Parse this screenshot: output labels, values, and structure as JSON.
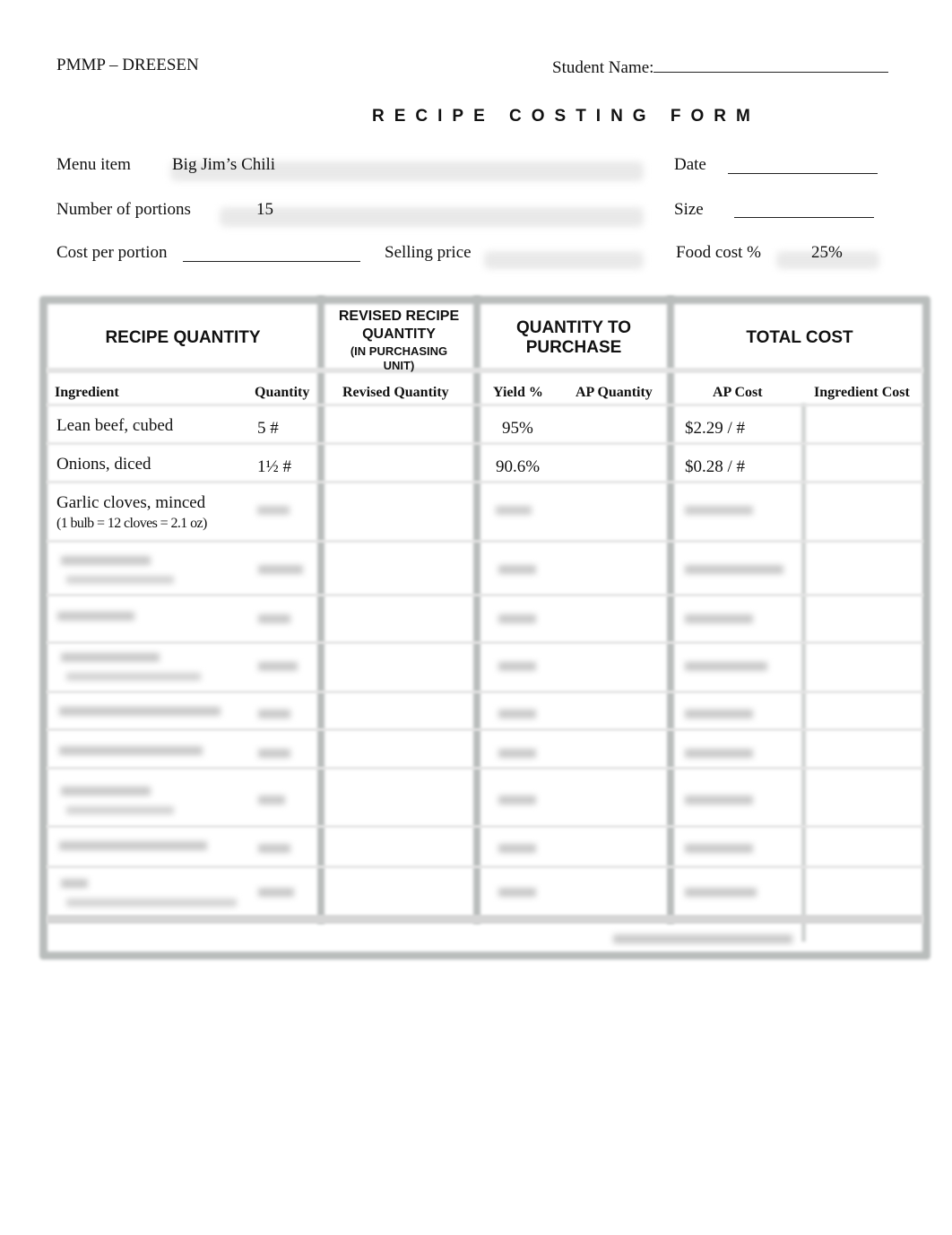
{
  "header": {
    "left": "PMMP – DREESEN",
    "student_name_label": "Student Name:"
  },
  "form_title": "RECIPE COSTING FORM",
  "fields": {
    "menu_item_label": "Menu item",
    "menu_item_value": "Big Jim’s Chili",
    "date_label": "Date",
    "portions_label": "Number of portions",
    "portions_value": "15",
    "size_label": "Size",
    "cost_per_portion_label": "Cost per portion",
    "selling_price_label": "Selling price",
    "food_cost_label": "Food cost %",
    "food_cost_value": "25%"
  },
  "table": {
    "group_headers": {
      "recipe_quantity": "RECIPE QUANTITY",
      "revised_line1": "REVISED RECIPE",
      "revised_line2": "QUANTITY",
      "revised_line3": "(IN PURCHASING",
      "revised_line4": "UNIT)",
      "purchase_line1": "QUANTITY TO",
      "purchase_line2": "PURCHASE",
      "total_cost": "TOTAL COST"
    },
    "columns": {
      "ingredient": "Ingredient",
      "quantity": "Quantity",
      "revised_quantity": "Revised Quantity",
      "yield": "Yield %",
      "ap_quantity": "AP Quantity",
      "ap_cost": "AP Cost",
      "ingredient_cost": "Ingredient Cost"
    },
    "rows": [
      {
        "ingredient": "Lean beef, cubed",
        "note": "",
        "quantity": "5 #",
        "revised_quantity": "",
        "yield": "95%",
        "ap_quantity": "",
        "ap_cost": "$2.29 / #",
        "ingredient_cost": ""
      },
      {
        "ingredient": "Onions, diced",
        "note": "",
        "quantity": "1½ #",
        "revised_quantity": "",
        "yield": "90.6%",
        "ap_quantity": "",
        "ap_cost": "$0.28 / #",
        "ingredient_cost": ""
      },
      {
        "ingredient": "Garlic cloves, minced",
        "note": "(1 bulb = 12 cloves = 2.1 oz)",
        "quantity": "",
        "revised_quantity": "",
        "yield": "",
        "ap_quantity": "",
        "ap_cost": "",
        "ingredient_cost": ""
      }
    ]
  }
}
